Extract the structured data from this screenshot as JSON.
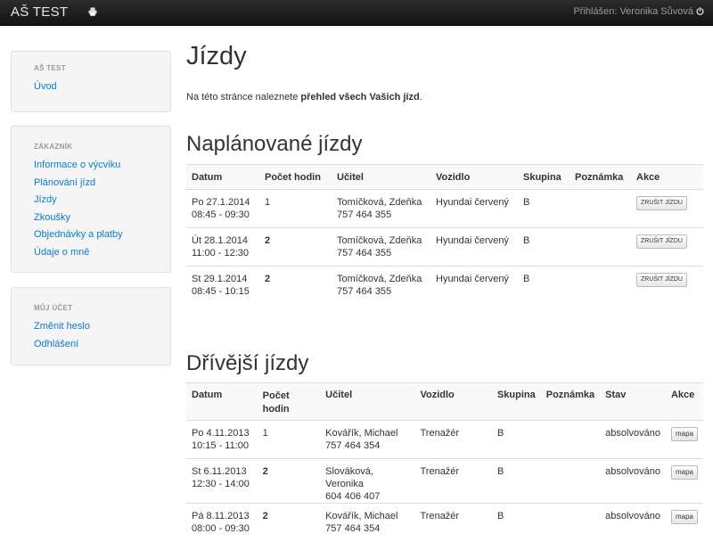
{
  "navbar": {
    "brand": "AŠ TEST",
    "user_label": "Přihlášen: Veronika Sůvová"
  },
  "sidebar": {
    "sections": [
      {
        "heading": "AŠ TEST",
        "items": [
          "Úvod"
        ]
      },
      {
        "heading": "ZÁKAZNÍK",
        "items": [
          "Informace o výcviku",
          "Plánování jízd",
          "Jízdy",
          "Zkoušky",
          "Objednávky a platby",
          "Údaje o mně"
        ]
      },
      {
        "heading": "MŮJ ÚČET",
        "items": [
          "Změnit heslo",
          "Odhlášení"
        ]
      }
    ]
  },
  "page": {
    "title": "Jízdy",
    "intro_prefix": "Na této stránce naleznete ",
    "intro_bold": "přehled všech Vašich jízd",
    "intro_suffix": "."
  },
  "planned": {
    "title": "Naplánované jízdy",
    "columns": [
      "Datum",
      "Počet hodin",
      "Učitel",
      "Vozidlo",
      "Skupina",
      "Poznámka",
      "Akce"
    ],
    "rows": [
      {
        "date": "Po 27.1.2014",
        "time": "08:45 - 09:30",
        "hours": "1",
        "teacher": "Tomíčková, Zdeňka",
        "phone": "757 464 355",
        "vehicle": "Hyundai červený",
        "group": "B",
        "note": "",
        "action": "ZRUŠIT JÍZDU"
      },
      {
        "date": "Út 28.1.2014",
        "time": "11:00 - 12:30",
        "hours": "2",
        "teacher": "Tomíčková, Zdeňka",
        "phone": "757 464 355",
        "vehicle": "Hyundai červený",
        "group": "B",
        "note": "",
        "action": "ZRUŠIT JÍZDU"
      },
      {
        "date": "St 29.1.2014",
        "time": "08:45 - 10:15",
        "hours": "2",
        "teacher": "Tomíčková, Zdeňka",
        "phone": "757 464 355",
        "vehicle": "Hyundai červený",
        "group": "B",
        "note": "",
        "action": "ZRUŠIT JÍZDU"
      }
    ]
  },
  "past": {
    "title": "Dřívější jízdy",
    "columns": [
      "Datum",
      "Počet hodin",
      "Učitel",
      "Vozidlo",
      "Skupina",
      "Poznámka",
      "Stav",
      "Akce"
    ],
    "rows": [
      {
        "date": "Po 4.11.2013",
        "time": "10:15 - 11:00",
        "hours": "1",
        "teacher": "Kovářík, Michael",
        "phone": "757 464 354",
        "vehicle": "Trenažér",
        "group": "B",
        "note": "",
        "status": "absolvováno",
        "action": "mapa"
      },
      {
        "date": "St 6.11.2013",
        "time": "12:30 - 14:00",
        "hours": "2",
        "teacher": "Slováková, Veronika",
        "phone": "604 406 407",
        "vehicle": "Trenažér",
        "group": "B",
        "note": "",
        "status": "absolvováno",
        "action": "mapa"
      },
      {
        "date": "Pá 8.11.2013",
        "time": "08:00 - 09:30",
        "hours": "2",
        "teacher": "Kovářík, Michael",
        "phone": "757 464 354",
        "vehicle": "Trenažér",
        "group": "B",
        "note": "",
        "status": "absolvováno",
        "action": "mapa"
      }
    ]
  }
}
